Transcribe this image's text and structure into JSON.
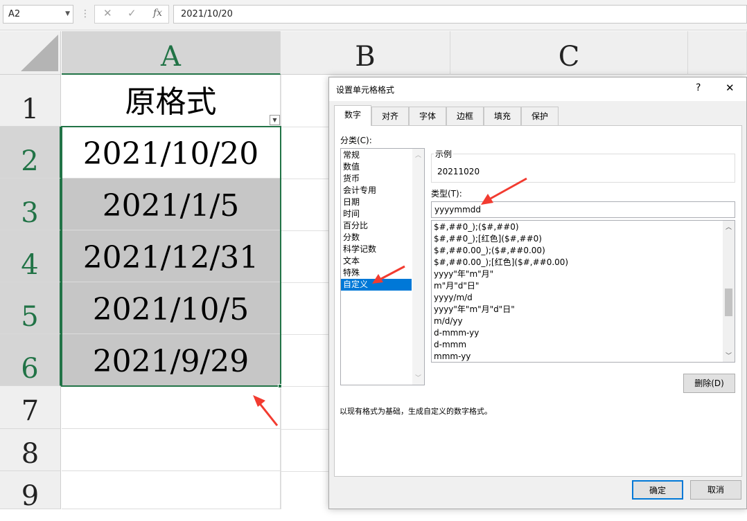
{
  "formula_bar": {
    "name_box": "A2",
    "separator": "⋮",
    "cancel_icon": "✕",
    "enter_icon": "✓",
    "function_icon": "fx",
    "content": "2021/10/20"
  },
  "columns": [
    "A",
    "B",
    "C"
  ],
  "rows": [
    "1",
    "2",
    "3",
    "4",
    "5",
    "6",
    "7",
    "8",
    "9"
  ],
  "cells": {
    "A1": "原格式",
    "A2": "2021/10/20",
    "A3": "2021/1/5",
    "A4": "2021/12/31",
    "A5": "2021/10/5",
    "A6": "2021/9/29"
  },
  "dialog": {
    "title": "设置单元格格式",
    "help": "?",
    "close": "✕",
    "tabs": [
      "数字",
      "对齐",
      "字体",
      "边框",
      "填充",
      "保护"
    ],
    "active_tab": "数字",
    "category_label": "分类(C):",
    "categories": [
      "常规",
      "数值",
      "货币",
      "会计专用",
      "日期",
      "时间",
      "百分比",
      "分数",
      "科学记数",
      "文本",
      "特殊",
      "自定义"
    ],
    "selected_category": "自定义",
    "sample_label": "示例",
    "sample_value": "20211020",
    "type_label": "类型(T):",
    "type_value": "yyyymmdd",
    "formats": [
      "$#,##0_);($#,##0)",
      "$#,##0_);[红色]($#,##0)",
      "$#,##0.00_);($#,##0.00)",
      "$#,##0.00_);[红色]($#,##0.00)",
      "yyyy\"年\"m\"月\"",
      "m\"月\"d\"日\"",
      "yyyy/m/d",
      "yyyy\"年\"m\"月\"d\"日\"",
      "m/d/yy",
      "d-mmm-yy",
      "d-mmm",
      "mmm-yy"
    ],
    "delete_button": "删除(D)",
    "description": "以现有格式为基础，生成自定义的数字格式。",
    "ok_button": "确定",
    "cancel_button": "取消"
  },
  "colors": {
    "excel_green": "#217346",
    "selection_blue": "#0078d7",
    "arrow_red": "#f23b30"
  }
}
